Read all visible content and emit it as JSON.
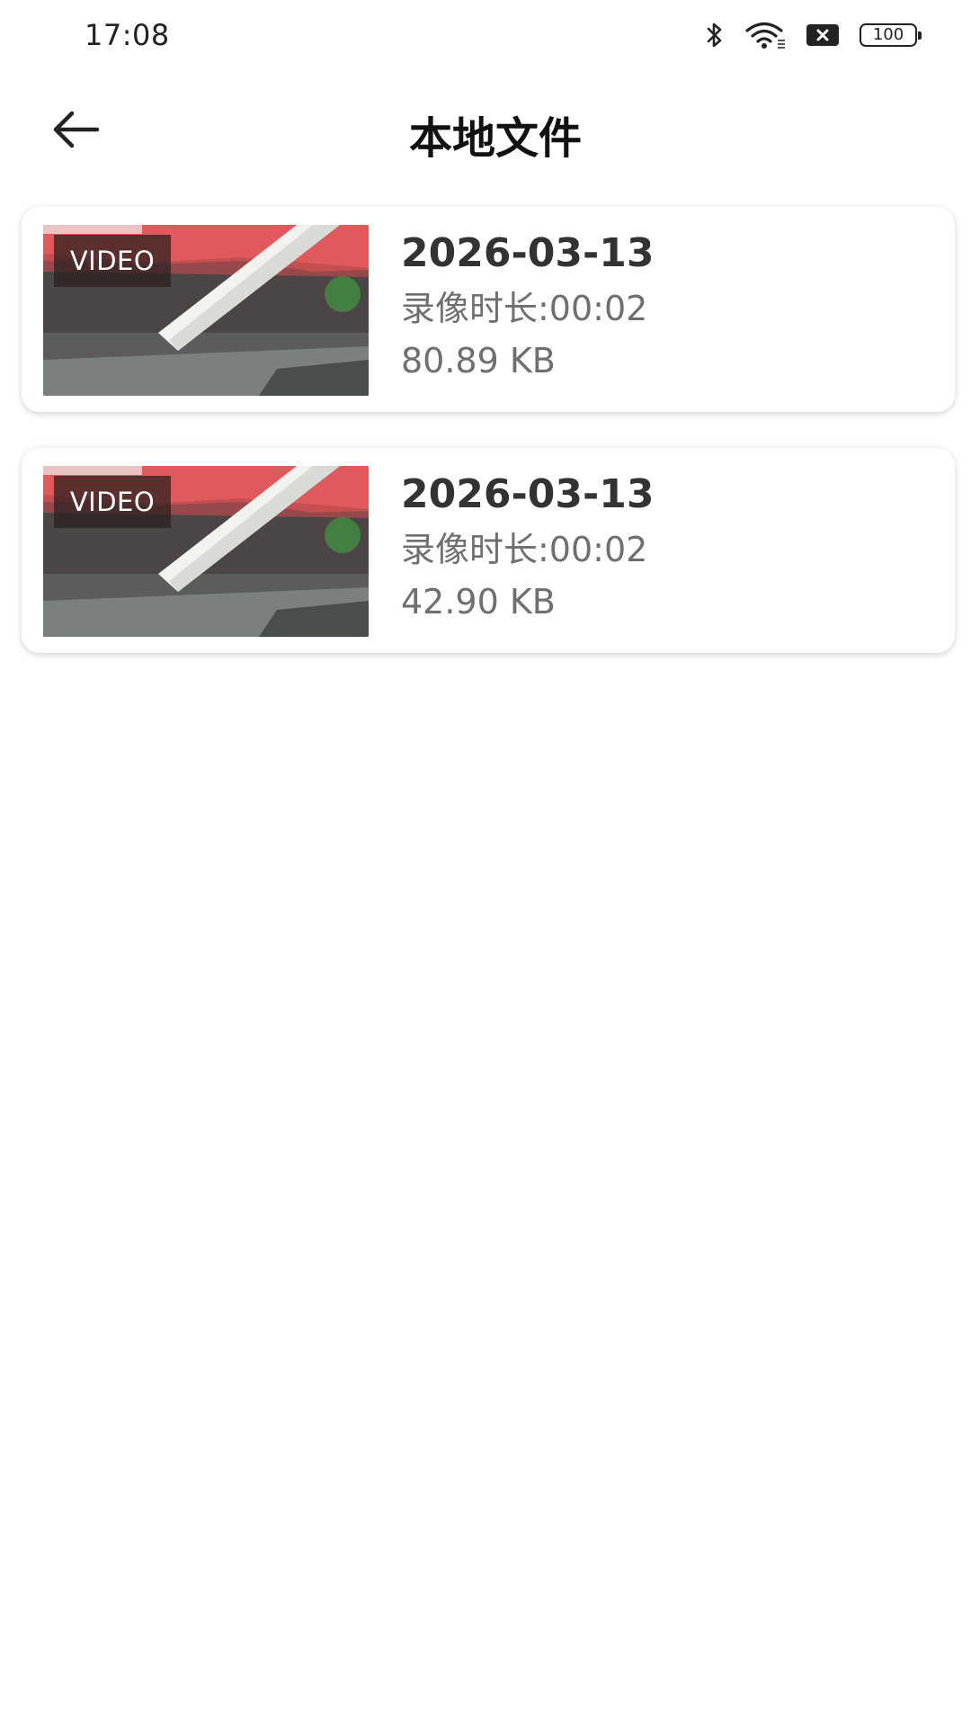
{
  "status_bar": {
    "time": "17:08",
    "icons": [
      "bluetooth-icon",
      "wifi-icon",
      "sim-off-icon",
      "battery-icon"
    ],
    "battery_level": "100"
  },
  "header": {
    "back_icon": "arrow-left-icon",
    "title": "本地文件"
  },
  "files": [
    {
      "badge": "VIDEO",
      "date": "2026-03-13",
      "duration": "录像时长:00:02",
      "size": "80.89 KB"
    },
    {
      "badge": "VIDEO",
      "date": "2026-03-13",
      "duration": "录像时长:00:02",
      "size": "42.90 KB"
    }
  ],
  "colors": {
    "background": "#ffffff",
    "title_text": "#111111",
    "date_text": "#333333",
    "meta_text": "#6f6f6f",
    "badge_bg": "#2a1e1eb8"
  }
}
